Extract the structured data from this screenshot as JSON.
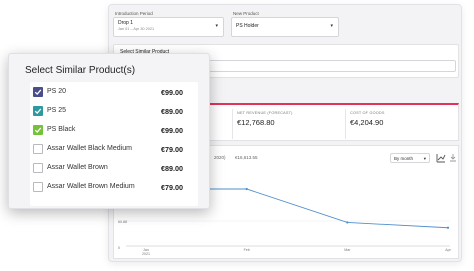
{
  "filters": {
    "intro_period_label": "Introduction Period",
    "intro_period_value": "Drop 1",
    "intro_period_dates": "Jan 01 – Apr 30 2021",
    "new_product_label": "New Product",
    "new_product_value": "PS Holder"
  },
  "similar_card": {
    "title": "Select Similar Product"
  },
  "kpis": [
    {
      "label": "NET REVENUE (FORECAST)",
      "value": "€12,768.80"
    },
    {
      "label": "COST OF GOODS",
      "value": "€4,204.90"
    }
  ],
  "chart": {
    "header_left": "2020)",
    "header_value": "€16,613.55",
    "granularity": "By month",
    "y_tick": "60.88",
    "x_ticks": [
      "Jan\n2021",
      "Feb",
      "Mar",
      "Apr"
    ],
    "y_origin": "0"
  },
  "chart_data": {
    "type": "line",
    "x": [
      "Jan 2021",
      "Feb",
      "Mar",
      "Apr"
    ],
    "series": [
      {
        "values": [
          75,
          75,
          31,
          24
        ]
      }
    ],
    "ylim": [
      0,
      100
    ]
  },
  "popup": {
    "title": "Select Similar Product(s)",
    "items": [
      {
        "label": "PS 20",
        "price": "€99.00",
        "checked": true,
        "color": "#4a4f8c"
      },
      {
        "label": "PS 25",
        "price": "€89.00",
        "checked": true,
        "color": "#2e9aa0"
      },
      {
        "label": "PS Black",
        "price": "€99.00",
        "checked": true,
        "color": "#73c23a"
      },
      {
        "label": "Assar Wallet Black Medium",
        "price": "€79.00",
        "checked": false,
        "color": ""
      },
      {
        "label": "Assar Wallet Brown",
        "price": "€89.00",
        "checked": false,
        "color": ""
      },
      {
        "label": "Assar Wallet Brown Medium",
        "price": "€79.00",
        "checked": false,
        "color": ""
      }
    ]
  }
}
